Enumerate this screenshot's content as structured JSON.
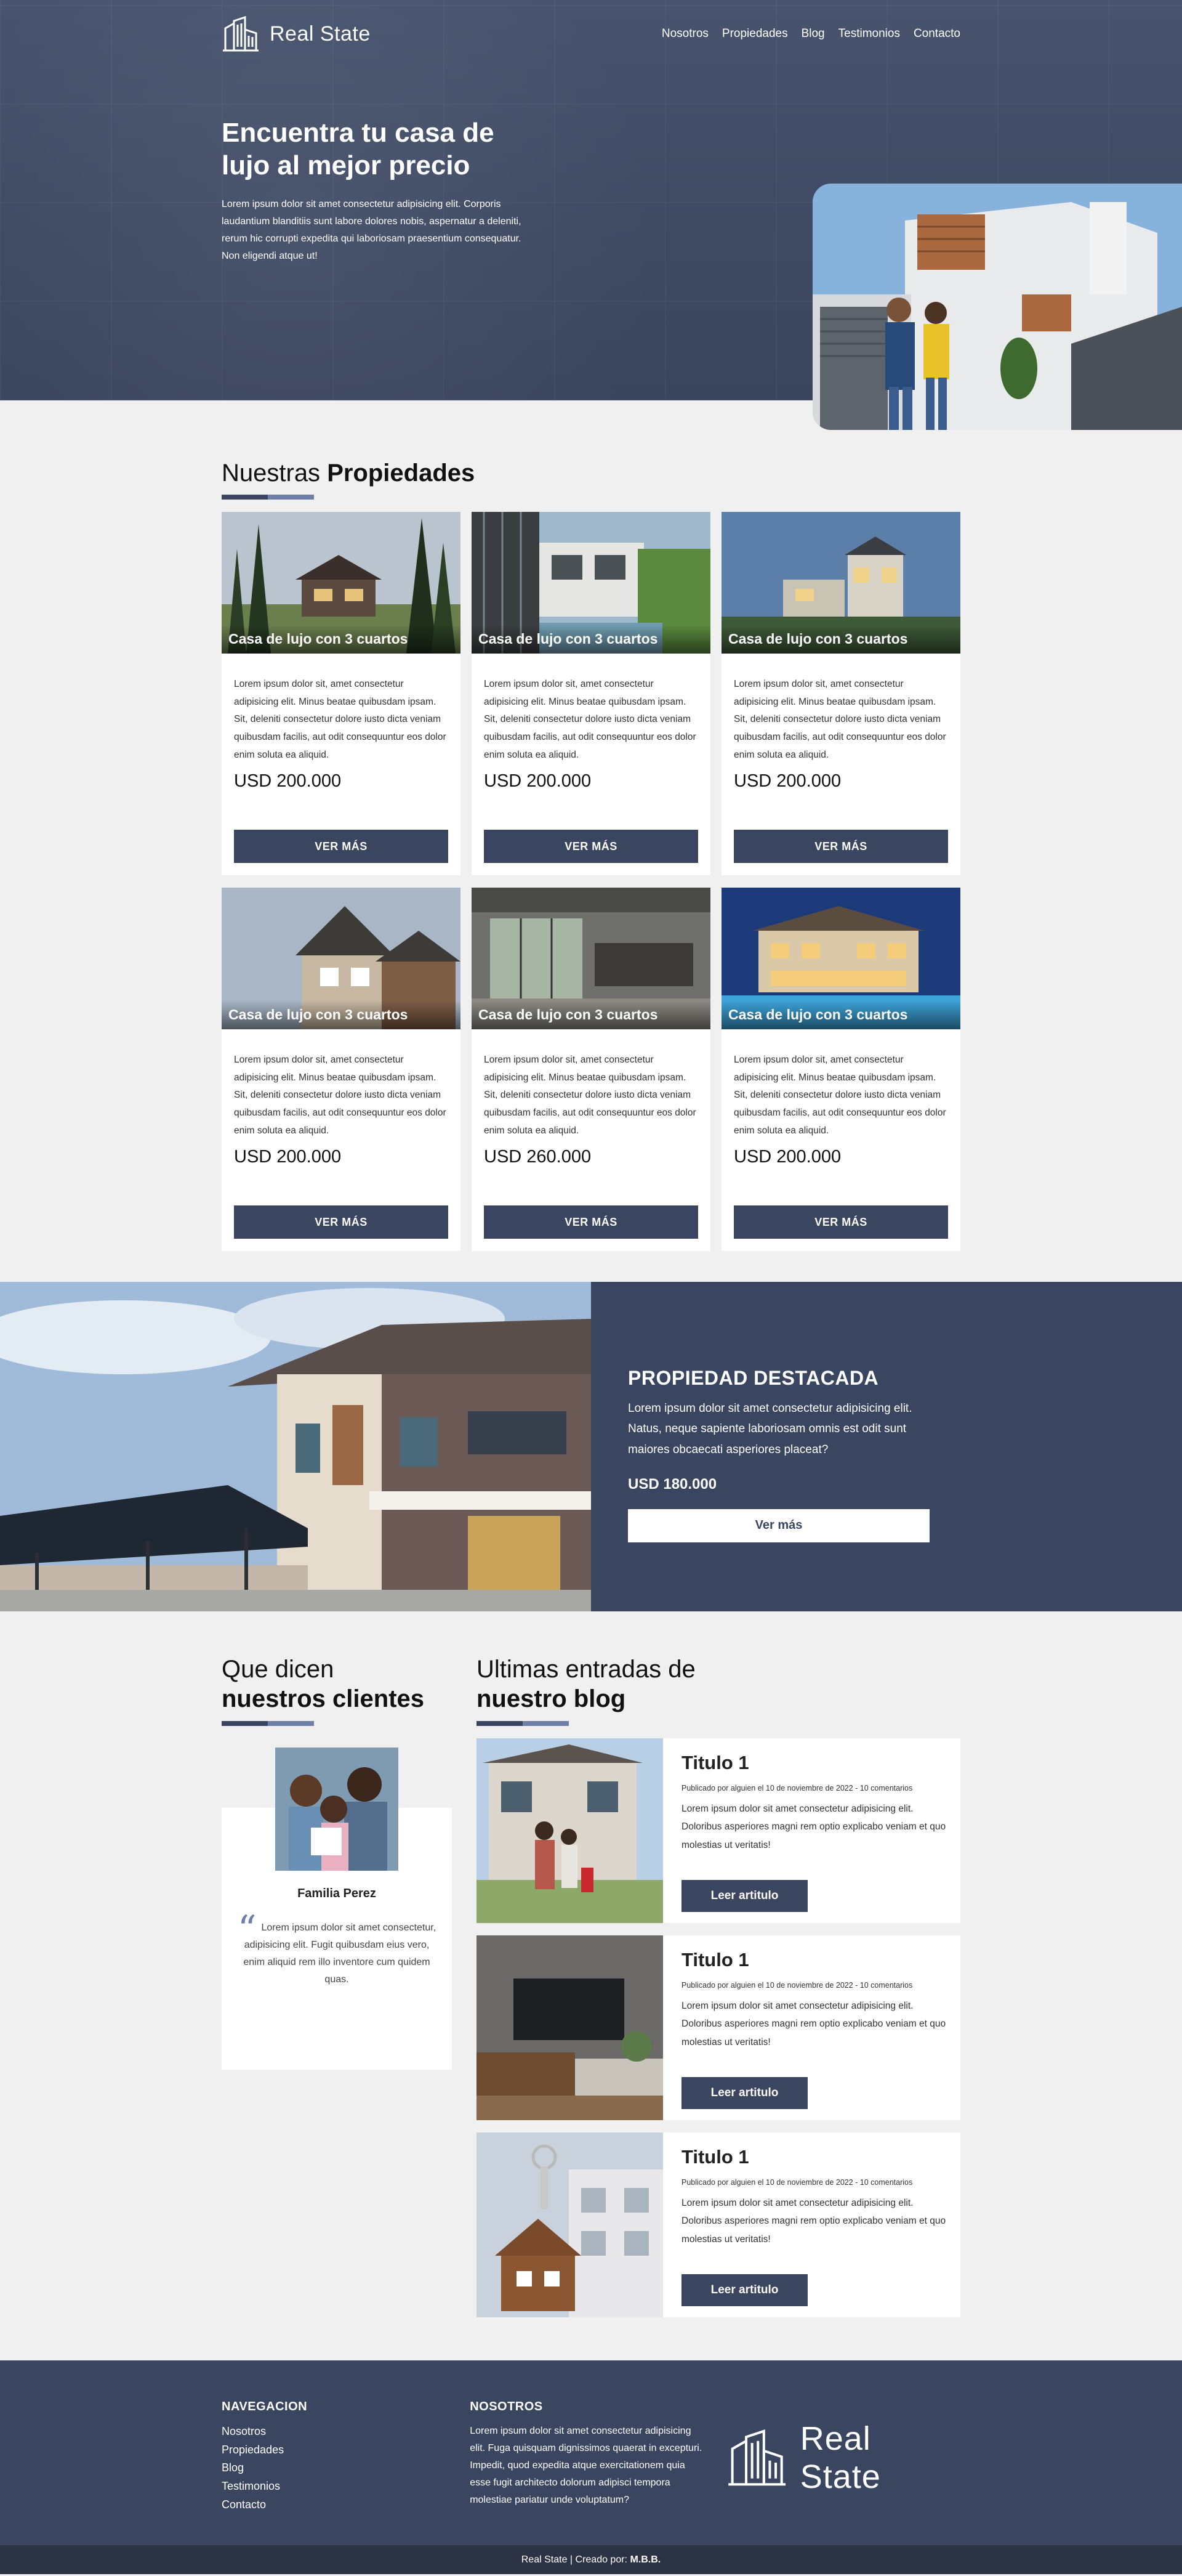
{
  "brand": {
    "name": "Real State"
  },
  "nav": {
    "items": [
      "Nosotros",
      "Propiedades",
      "Blog",
      "Testimonios",
      "Contacto"
    ]
  },
  "hero": {
    "title": "Encuentra tu casa de lujo al mejor precio",
    "text": "Lorem ipsum dolor sit amet consectetur adipisicing elit. Corporis laudantium blanditiis sunt labore dolores nobis, aspernatur a deleniti, rerum hic corrupti expedita qui laboriosam praesentium consequatur. Non eligendi atque ut!"
  },
  "properties": {
    "title_light": "Nuestras",
    "title_bold": "Propiedades",
    "items": [
      {
        "title": "Casa de lujo con 3 cuartos",
        "text": "Lorem ipsum dolor sit, amet consectetur adipisicing elit. Minus beatae quibusdam ipsam. Sit, deleniti consectetur dolore iusto dicta veniam quibusdam facilis, aut odit consequuntur eos dolor enim soluta ea aliquid.",
        "price": "USD 200.000",
        "button": "VER MÁS"
      },
      {
        "title": "Casa de lujo con 3 cuartos",
        "text": "Lorem ipsum dolor sit, amet consectetur adipisicing elit. Minus beatae quibusdam ipsam. Sit, deleniti consectetur dolore iusto dicta veniam quibusdam facilis, aut odit consequuntur eos dolor enim soluta ea aliquid.",
        "price": "USD 200.000",
        "button": "VER MÁS"
      },
      {
        "title": "Casa de lujo con 3 cuartos",
        "text": "Lorem ipsum dolor sit, amet consectetur adipisicing elit. Minus beatae quibusdam ipsam. Sit, deleniti consectetur dolore iusto dicta veniam quibusdam facilis, aut odit consequuntur eos dolor enim soluta ea aliquid.",
        "price": "USD 200.000",
        "button": "VER MÁS"
      },
      {
        "title": "Casa de lujo con 3 cuartos",
        "text": "Lorem ipsum dolor sit, amet consectetur adipisicing elit. Minus beatae quibusdam ipsam. Sit, deleniti consectetur dolore iusto dicta veniam quibusdam facilis, aut odit consequuntur eos dolor enim soluta ea aliquid.",
        "price": "USD 200.000",
        "button": "VER MÁS"
      },
      {
        "title": "Casa de lujo con 3 cuartos",
        "text": "Lorem ipsum dolor sit, amet consectetur adipisicing elit. Minus beatae quibusdam ipsam. Sit, deleniti consectetur dolore iusto dicta veniam quibusdam facilis, aut odit consequuntur eos dolor enim soluta ea aliquid.",
        "price": "USD 260.000",
        "button": "VER MÁS"
      },
      {
        "title": "Casa de lujo con 3 cuartos",
        "text": "Lorem ipsum dolor sit, amet consectetur adipisicing elit. Minus beatae quibusdam ipsam. Sit, deleniti consectetur dolore iusto dicta veniam quibusdam facilis, aut odit consequuntur eos dolor enim soluta ea aliquid.",
        "price": "USD 200.000",
        "button": "VER MÁS"
      }
    ]
  },
  "featured": {
    "title": "PROPIEDAD DESTACADA",
    "text": "Lorem ipsum dolor sit amet consectetur adipisicing elit. Natus, neque sapiente laboriosam omnis est odit sunt maiores obcaecati asperiores placeat?",
    "price": "USD 180.000",
    "button": "Ver más"
  },
  "clients": {
    "title_light": "Que dicen",
    "title_bold": "nuestros clientes",
    "name": "Familia Perez",
    "text": "Lorem ipsum dolor sit amet consectetur, adipisicing elit. Fugit quibusdam eius vero, enim aliquid rem illo inventore cum quidem quas."
  },
  "blog": {
    "title_light": "Ultimas entradas de",
    "title_bold": "nuestro blog",
    "entries": [
      {
        "title": "Titulo 1",
        "meta": "Publicado por alguien el 10 de noviembre de 2022 - 10 comentarios",
        "text": "Lorem ipsum dolor sit amet consectetur adipisicing elit. Doloribus asperiores magni rem optio explicabo veniam et quo molestias ut veritatis!",
        "button": "Leer artitulo"
      },
      {
        "title": "Titulo 1",
        "meta": "Publicado por alguien el 10 de noviembre de 2022 - 10 comentarios",
        "text": "Lorem ipsum dolor sit amet consectetur adipisicing elit. Doloribus asperiores magni rem optio explicabo veniam et quo molestias ut veritatis!",
        "button": "Leer artitulo"
      },
      {
        "title": "Titulo 1",
        "meta": "Publicado por alguien el 10 de noviembre de 2022 - 10 comentarios",
        "text": "Lorem ipsum dolor sit amet consectetur adipisicing elit. Doloribus asperiores magni rem optio explicabo veniam et quo molestias ut veritatis!",
        "button": "Leer artitulo"
      }
    ]
  },
  "footer": {
    "nav_title": "NAVEGACION",
    "nav_items": [
      "Nosotros",
      "Propiedades",
      "Blog",
      "Testimonios",
      "Contacto"
    ],
    "about_title": "NOSOTROS",
    "about_text": "Lorem ipsum dolor sit amet consectetur adipisicing elit. Fuga quisquam dignissimos quaerat in excepturi. Impedit, quod expedita atque exercitationem quia esse fugit architecto dolorum adipisci tempora molestiae pariatur unde voluptatum?",
    "copyright": "Real State | Creado por:",
    "author": "M.B.B."
  },
  "colors": {
    "primary": "#3a4560",
    "accent": "#6e7fa8",
    "background": "#f0f0f0"
  }
}
